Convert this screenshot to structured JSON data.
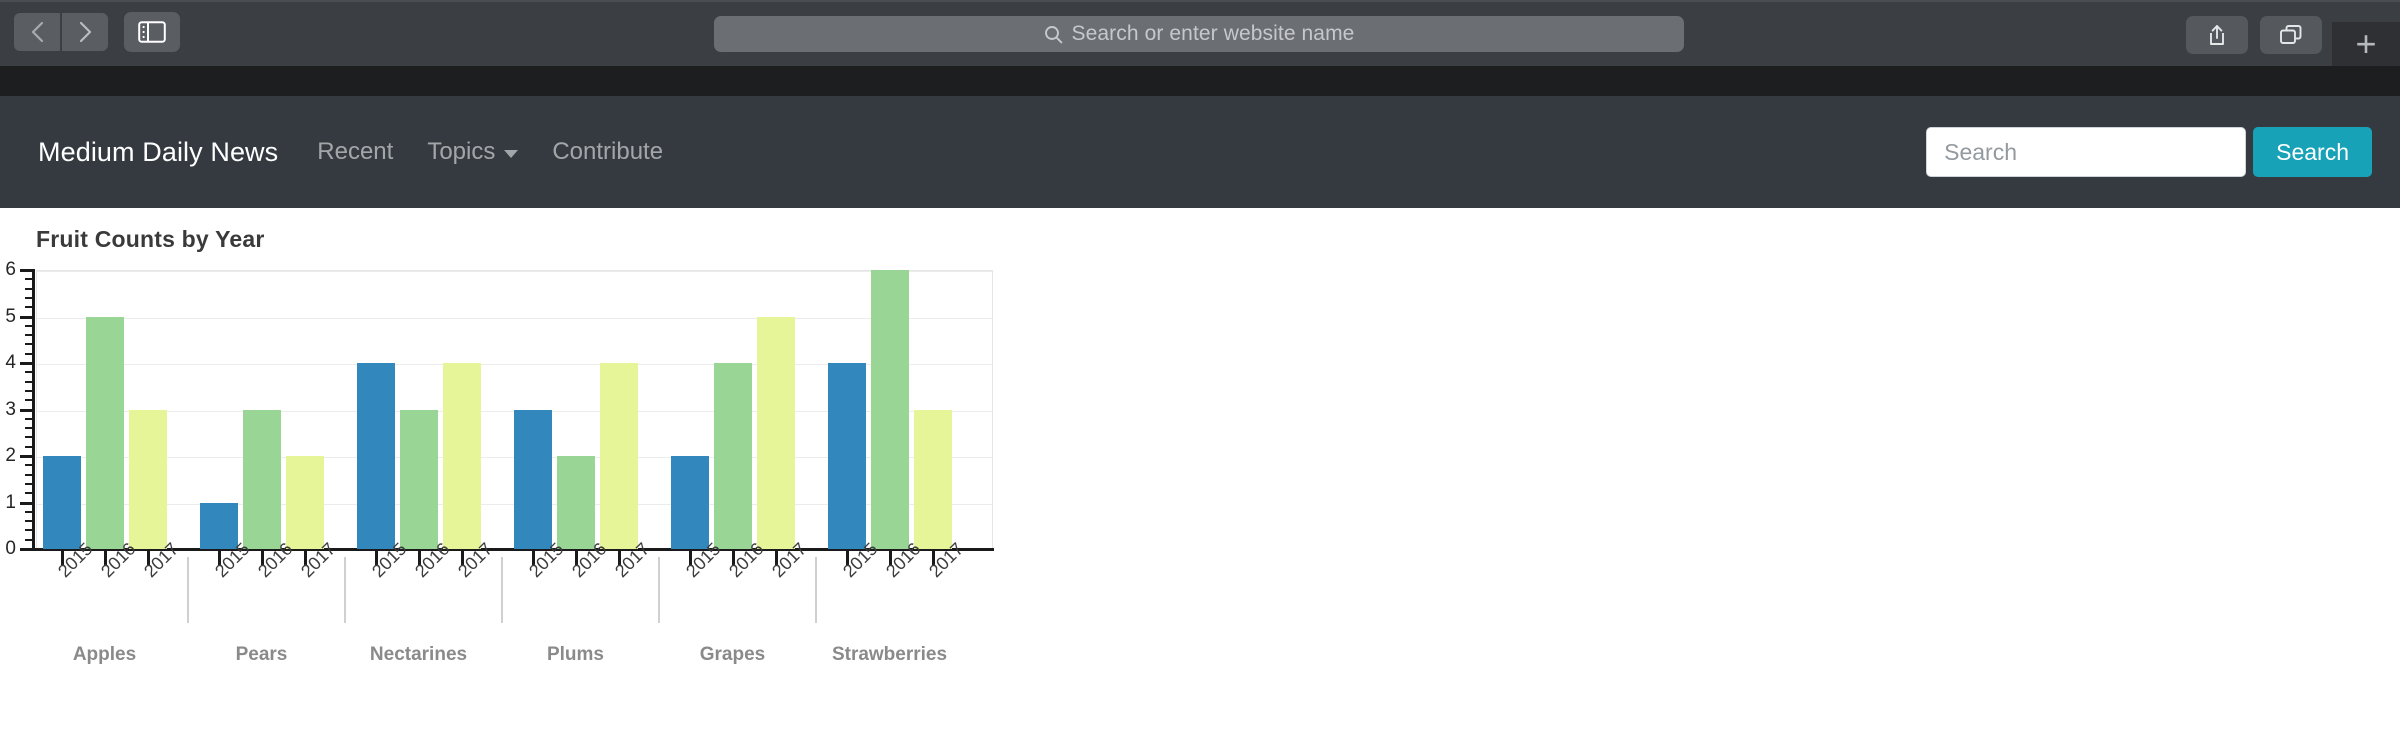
{
  "browser": {
    "back_icon": "chevron-left-icon",
    "forward_icon": "chevron-right-icon",
    "sidebar_icon": "sidebar-toggle-icon",
    "address_placeholder": "Search or enter website name",
    "address_search_icon": "search-icon",
    "share_icon": "share-icon",
    "tab_overview_icon": "tab-overview-icon",
    "new_tab_label": "+"
  },
  "navbar": {
    "brand": "Medium Daily News",
    "links": [
      {
        "label": "Recent",
        "has_caret": false
      },
      {
        "label": "Topics",
        "has_caret": true
      },
      {
        "label": "Contribute",
        "has_caret": false
      }
    ],
    "search_placeholder": "Search",
    "search_value": "",
    "search_button_label": "Search",
    "accent_color": "#17a2b8",
    "background_color": "#343a40"
  },
  "chart_data": {
    "type": "bar",
    "title": "Fruit Counts by Year",
    "xlabel": "",
    "ylabel": "",
    "ylim": [
      0,
      6
    ],
    "yticks": [
      0,
      1,
      2,
      3,
      4,
      5,
      6
    ],
    "minor_ticks_per_interval": 4,
    "grid": true,
    "legend": "none",
    "categories": [
      "Apples",
      "Pears",
      "Nectarines",
      "Plums",
      "Grapes",
      "Strawberries"
    ],
    "subcategories": [
      "2015",
      "2016",
      "2017"
    ],
    "series": [
      {
        "name": "2015",
        "color": "#3288bd",
        "values": [
          2,
          1,
          4,
          3,
          2,
          4
        ]
      },
      {
        "name": "2016",
        "color": "#99d594",
        "values": [
          5,
          3,
          3,
          2,
          4,
          6
        ]
      },
      {
        "name": "2017",
        "color": "#e6f598",
        "values": [
          3,
          2,
          4,
          4,
          5,
          3
        ]
      }
    ]
  }
}
